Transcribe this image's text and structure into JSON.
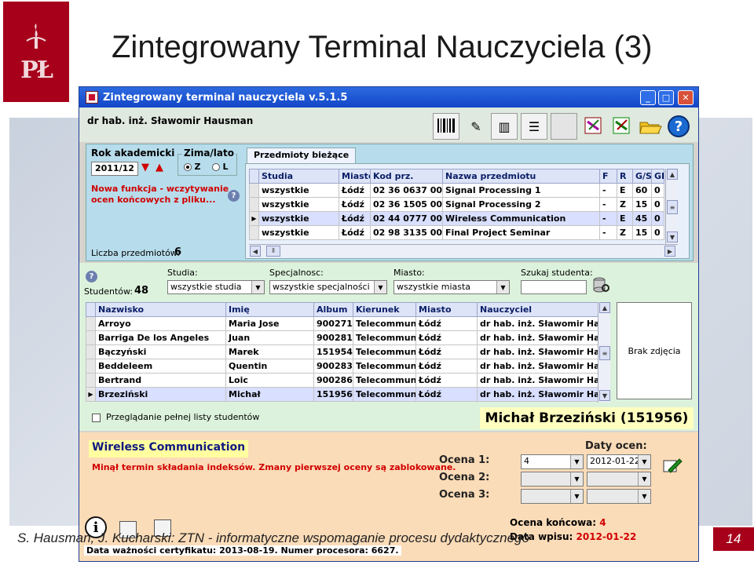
{
  "slide": {
    "title": "Zintegrowany Terminal Nauczyciela (3)",
    "logo_text": "PŁ",
    "footer": "S. Hausman, J. Kucharski: ZTN - informatyczne wspomaganie procesu dydaktycznego",
    "page_number": "14"
  },
  "app": {
    "window_title": "Zintegrowany terminal nauczyciela v.5.1.5",
    "user_name": "dr hab. inż. Sławomir Hausman",
    "window_buttons": {
      "minimize": "_",
      "maximize": "□",
      "close": "✕"
    },
    "toolbar_help": "?"
  },
  "courses_panel": {
    "academic_year_label": "Rok akademicki",
    "academic_year_value": "2011/12",
    "semester_label": "Zima/lato",
    "semester_options": [
      "Z",
      "L"
    ],
    "semester_selected": "Z",
    "new_feature_line1": "Nowa funkcja - wczytywanie",
    "new_feature_line2": "ocen końcowych z pliku...",
    "help": "?",
    "course_count_label": "Liczba przedmiotów:",
    "course_count": "6",
    "tab_label": "Przedmioty bieżące",
    "columns": [
      "Studia",
      "Miasto",
      "Kod prz.",
      "Nazwa przedmiotu",
      "F",
      "R",
      "G/S",
      "GP"
    ],
    "rows": [
      [
        "wszystkie",
        "Łódź",
        "02 36 0637 00",
        "Signal Processing 1",
        "-",
        "E",
        "60",
        "0"
      ],
      [
        "wszystkie",
        "Łódź",
        "02 36 1505 00",
        "Signal Processing 2",
        "-",
        "Z",
        "15",
        "0"
      ],
      [
        "wszystkie",
        "Łódź",
        "02 44 0777 00",
        "Wireless Communication",
        "-",
        "E",
        "45",
        "0"
      ],
      [
        "wszystkie",
        "Łódź",
        "02 98 3135 00",
        "Final Project Seminar",
        "-",
        "Z",
        "15",
        "0"
      ]
    ],
    "current_row": 2
  },
  "students_panel": {
    "help": "?",
    "students_label": "Studentów:",
    "students_count": "48",
    "studia_label": "Studia:",
    "studia_value": "wszystkie studia",
    "specjalnosc_label": "Specjalnosc:",
    "specjalnosc_value": "wszystkie specjalności",
    "miasto_label": "Miasto:",
    "miasto_value": "wszystkie miasta",
    "search_label": "Szukaj studenta:",
    "search_value": "",
    "columns": [
      "Nazwisko",
      "Imię",
      "Album",
      "Kierunek",
      "Miasto",
      "Nauczyciel"
    ],
    "rows": [
      [
        "Arroyo",
        "Maria Jose",
        "900271",
        "Telecommun",
        "Łódź",
        "dr hab. inż. Sławomir Hau"
      ],
      [
        "Barriga De los Angeles",
        "Juan",
        "900281",
        "Telecommun",
        "Łódź",
        "dr hab. inż. Sławomir Hau"
      ],
      [
        "Bączyński",
        "Marek",
        "151954",
        "Telecommun",
        "Łódź",
        "dr hab. inż. Sławomir Hau"
      ],
      [
        "Beddeleem",
        "Quentin",
        "900283",
        "Telecommun",
        "Łódź",
        "dr hab. inż. Sławomir Hau"
      ],
      [
        "Bertrand",
        "Loic",
        "900286",
        "Telecommun",
        "Łódź",
        "dr hab. inż. Sławomir Hau"
      ],
      [
        "Brzeziński",
        "Michał",
        "151956",
        "Telecommun",
        "Łódź",
        "dr hab. inż. Sławomir Hau"
      ]
    ],
    "current_row": 5,
    "photo_text": "Brak zdjęcia",
    "full_list_label": "Przeglądanie pełnej listy studentów",
    "selected_student": "Michał Brzeziński (151956)"
  },
  "grades_panel": {
    "course_name": "Wireless Communication",
    "warning": "Minął termin składania indeksów. Zmany pierwszej oceny są zablokowane.",
    "dates_label": "Daty ocen:",
    "grade1_label": "Ocena 1:",
    "grade1_value": "4",
    "grade1_date": "2012-01-22",
    "grade2_label": "Ocena 2:",
    "grade3_label": "Ocena 3:",
    "final_label": "Ocena końcowa:",
    "final_value": "4",
    "entry_label": "Data wpisu:",
    "entry_value": "2012-01-22",
    "certificate_text": "Data ważności certyfikatu: 2013-08-19. Numer procesora: 6627.",
    "info_icon_text": "i"
  }
}
